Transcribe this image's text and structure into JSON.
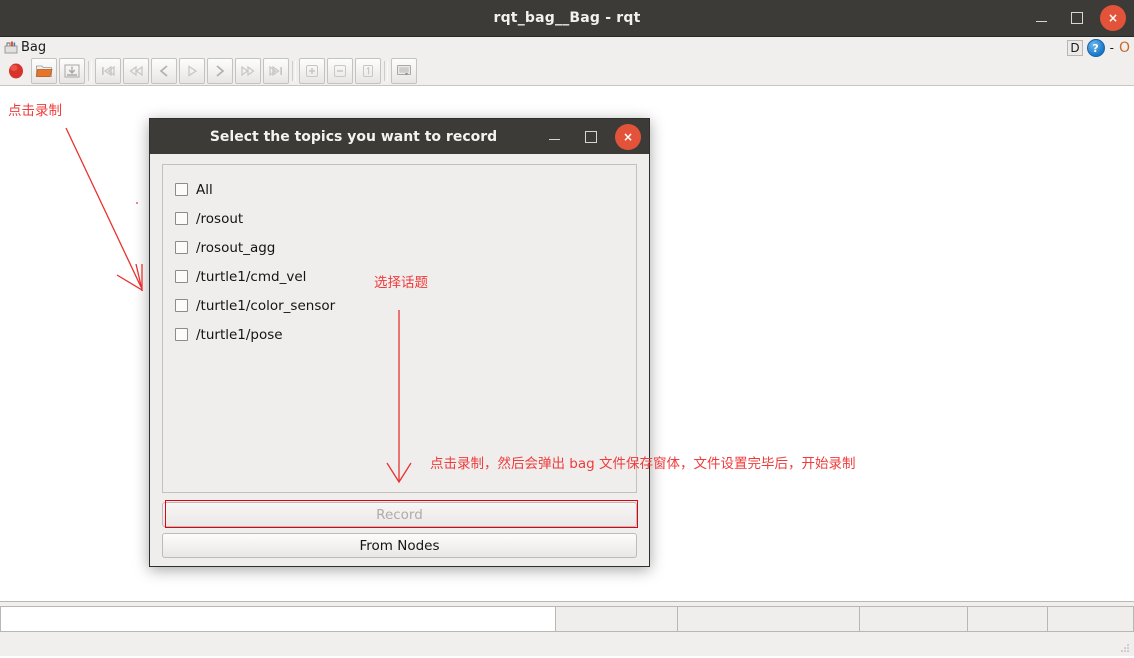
{
  "window": {
    "title": "rqt_bag__Bag - rqt",
    "controls": {
      "minimize": "minimize-icon",
      "maximize": "maximize-icon",
      "close": "×"
    }
  },
  "dock": {
    "title": "Bag",
    "icon": "bag-icon",
    "undock_label": "D",
    "help_label": "?",
    "minimize_label": "-",
    "close_label": "O"
  },
  "toolbar": {
    "buttons": [
      {
        "name": "record-button",
        "label": "Record",
        "icon": "record-circle-icon",
        "enabled": true
      },
      {
        "name": "load-bag-button",
        "label": "Load Bag",
        "icon": "open-folder-icon",
        "enabled": true
      },
      {
        "name": "save-bag-button",
        "label": "Save Bag",
        "icon": "save-disk-icon",
        "enabled": false
      },
      {
        "name": "skip-to-start-button",
        "label": "Begin",
        "icon": "skip-to-start-icon",
        "enabled": false
      },
      {
        "name": "rewind-button",
        "label": "Rewind",
        "icon": "rewind-icon",
        "enabled": false
      },
      {
        "name": "step-back-button",
        "label": "Previous",
        "icon": "step-back-icon",
        "enabled": false
      },
      {
        "name": "play-button",
        "label": "Play",
        "icon": "play-icon",
        "enabled": false
      },
      {
        "name": "step-forward-button",
        "label": "Next",
        "icon": "step-forward-icon",
        "enabled": false
      },
      {
        "name": "fast-forward-button",
        "label": "Fast Forward",
        "icon": "fast-forward-icon",
        "enabled": false
      },
      {
        "name": "skip-to-end-button",
        "label": "End",
        "icon": "skip-to-end-icon",
        "enabled": false
      },
      {
        "name": "zoom-in-button",
        "label": "Zoom In",
        "icon": "zoom-in-icon",
        "enabled": false
      },
      {
        "name": "zoom-out-button",
        "label": "Zoom Out",
        "icon": "zoom-out-icon",
        "enabled": false
      },
      {
        "name": "zoom-reset-button",
        "label": "Zoom 1:1",
        "icon": "zoom-one-to-one-icon",
        "enabled": false
      },
      {
        "name": "thumbnail-button",
        "label": "Thumbnails",
        "icon": "thumbnail-screen-icon",
        "enabled": false
      }
    ]
  },
  "dialog": {
    "title": "Select the topics you want to record",
    "controls": {
      "minimize": "minimize-icon",
      "maximize": "maximize-icon",
      "close": "×"
    },
    "topics": [
      {
        "label": "All",
        "checked": false
      },
      {
        "label": "/rosout",
        "checked": false
      },
      {
        "label": "/rosout_agg",
        "checked": false
      },
      {
        "label": "/turtle1/cmd_vel",
        "checked": false
      },
      {
        "label": "/turtle1/color_sensor",
        "checked": false
      },
      {
        "label": "/turtle1/pose",
        "checked": false
      }
    ],
    "record_button": {
      "label": "Record",
      "enabled": false
    },
    "from_nodes_button": {
      "label": "From Nodes",
      "enabled": true
    }
  },
  "annotations": {
    "color": "#ef3b3b",
    "click_record": "点击录制",
    "select_topic": "选择话题",
    "record_flow": "点击录制，然后会弹出 bag 文件保存窗体，文件设置完毕后，开始录制"
  },
  "statusbar": {
    "segments": [
      "",
      "",
      "",
      "",
      "",
      ""
    ]
  },
  "colors": {
    "titlebar_bg": "#3c3b37",
    "close_red": "#e2533a",
    "record_red": "#d8332a",
    "annotation_red": "#ef3b3b",
    "panel_bg": "#efeeed",
    "help_blue": "#1978c8"
  }
}
